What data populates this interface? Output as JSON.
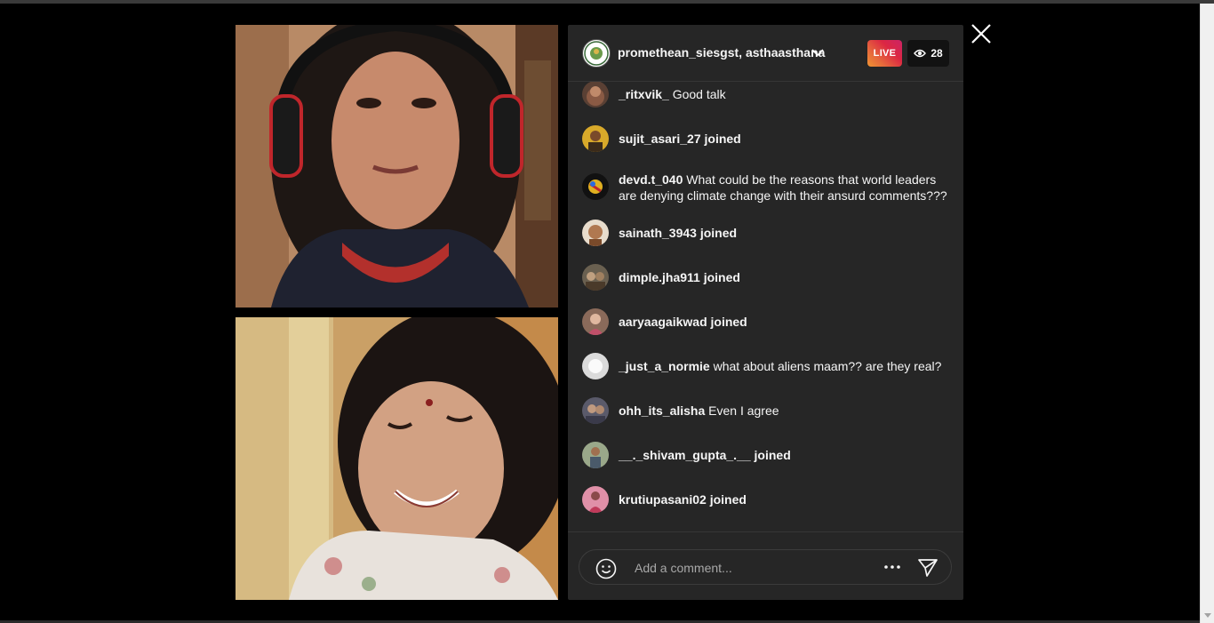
{
  "header": {
    "host_names": "promethean_siesgst, asthaasthana",
    "live_label": "LIVE",
    "viewer_count": "28"
  },
  "comments": [
    {
      "user": "_ritxvik_",
      "text": "Good talk"
    },
    {
      "user": "sujit_asari_27",
      "text": "joined"
    },
    {
      "user": "devd.t_040",
      "text": "What could be the reasons that world leaders are denying climate change with their ansurd comments???"
    },
    {
      "user": "sainath_3943",
      "text": "joined"
    },
    {
      "user": "dimple.jha911",
      "text": "joined"
    },
    {
      "user": "aaryaagaikwad",
      "text": "joined"
    },
    {
      "user": "_just_a_normie",
      "text": "what about aliens maam?? are they real?"
    },
    {
      "user": "ohh_its_alisha",
      "text": "Even I agree"
    },
    {
      "user": "__._shivam_gupta_.__",
      "text": "joined"
    },
    {
      "user": "krutiupasani02",
      "text": "joined"
    }
  ],
  "footer": {
    "comment_placeholder": "Add a comment..."
  },
  "colors": {
    "panel_bg": "#262626",
    "page_bg": "#000000",
    "live_gradient": [
      "#f09433",
      "#dc2743",
      "#cc2366"
    ]
  },
  "icons": [
    "close-icon",
    "chevron-down-icon",
    "eye-icon",
    "emoji-icon",
    "more-icon",
    "send-icon"
  ]
}
